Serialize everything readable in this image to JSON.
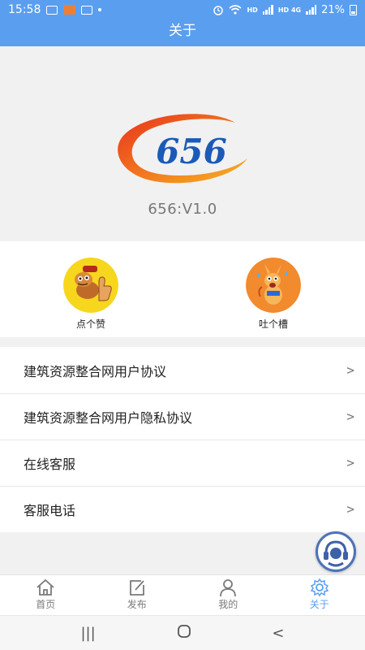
{
  "status_bar": {
    "time": "15:58",
    "battery": "21%",
    "network_1": "HD",
    "network_2": "HD 4G"
  },
  "title_bar": {
    "title": "关于"
  },
  "app_info": {
    "logo_text": "656",
    "version": "656:V1.0",
    "logo_colors": [
      "#e8331c",
      "#f5a623",
      "#1a5ab8"
    ]
  },
  "actions": [
    {
      "label": "点个赞",
      "icon": "thumbs-up-dog-icon",
      "color": "#f7d61e"
    },
    {
      "label": "吐个槽",
      "icon": "complaining-kangaroo-icon",
      "color": "#f28a2e"
    }
  ],
  "menu": [
    {
      "label": "建筑资源整合网用户协议",
      "arrow": ">"
    },
    {
      "label": "建筑资源整合网用户隐私协议",
      "arrow": ">"
    },
    {
      "label": "在线客服",
      "arrow": ">"
    },
    {
      "label": "客服电话",
      "arrow": ">"
    }
  ],
  "float_button": {
    "icon": "customer-service-headset-icon"
  },
  "tabs": [
    {
      "label": "首页",
      "icon": "home-icon",
      "active": false
    },
    {
      "label": "发布",
      "icon": "edit-icon",
      "active": false
    },
    {
      "label": "我的",
      "icon": "person-icon",
      "active": false
    },
    {
      "label": "关于",
      "icon": "gear-icon",
      "active": true
    }
  ],
  "nav_bar": {
    "recents_icon": "recents-icon",
    "home_icon": "home-circle-icon",
    "back_icon": "back-icon",
    "recents_glyph": "|||",
    "back_glyph": "<"
  },
  "accent_color": "#5a9ef0"
}
